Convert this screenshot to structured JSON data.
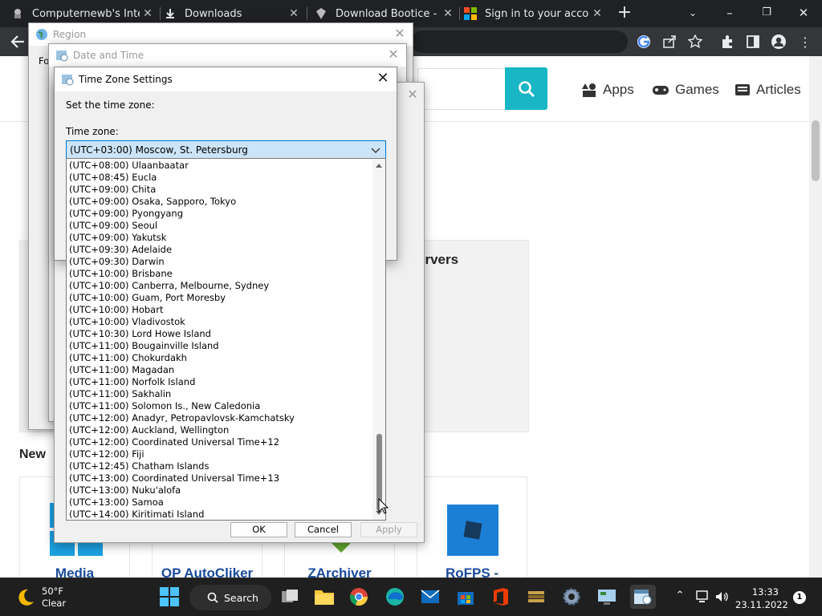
{
  "tabs": [
    {
      "title": "Computernewb's Intern",
      "close": "✕"
    },
    {
      "title": "Downloads",
      "close": "✕"
    },
    {
      "title": "Download Bootice - fre",
      "close": "✕"
    },
    {
      "title": "Sign in to your account",
      "close": "✕"
    }
  ],
  "window_controls": {
    "minimize": "–",
    "maximize": "❐",
    "close": "✕"
  },
  "site": {
    "nav": [
      {
        "label": "Apps"
      },
      {
        "label": "Games"
      },
      {
        "label": "Articles"
      }
    ],
    "servers_heading": "ervers",
    "new_heading": "New",
    "apps": [
      {
        "label": "Media"
      },
      {
        "label": "OP AutoCliker"
      },
      {
        "label": "ZArchiver"
      },
      {
        "label": "RoFPS -"
      }
    ]
  },
  "region_dialog": {
    "title": "Region",
    "fragment": "Fo"
  },
  "datetime_dialog": {
    "title": "Date and Time"
  },
  "timezone_dialog": {
    "title": "Time Zone Settings",
    "prompt": "Set the time zone:",
    "field_label": "Time zone:",
    "selected": "(UTC+03:00) Moscow, St. Petersburg",
    "options": [
      "(UTC+08:00) Ulaanbaatar",
      "(UTC+08:45) Eucla",
      "(UTC+09:00) Chita",
      "(UTC+09:00) Osaka, Sapporo, Tokyo",
      "(UTC+09:00) Pyongyang",
      "(UTC+09:00) Seoul",
      "(UTC+09:00) Yakutsk",
      "(UTC+09:30) Adelaide",
      "(UTC+09:30) Darwin",
      "(UTC+10:00) Brisbane",
      "(UTC+10:00) Canberra, Melbourne, Sydney",
      "(UTC+10:00) Guam, Port Moresby",
      "(UTC+10:00) Hobart",
      "(UTC+10:00) Vladivostok",
      "(UTC+10:30) Lord Howe Island",
      "(UTC+11:00) Bougainville Island",
      "(UTC+11:00) Chokurdakh",
      "(UTC+11:00) Magadan",
      "(UTC+11:00) Norfolk Island",
      "(UTC+11:00) Sakhalin",
      "(UTC+11:00) Solomon Is., New Caledonia",
      "(UTC+12:00) Anadyr, Petropavlovsk-Kamchatsky",
      "(UTC+12:00) Auckland, Wellington",
      "(UTC+12:00) Coordinated Universal Time+12",
      "(UTC+12:00) Fiji",
      "(UTC+12:45) Chatham Islands",
      "(UTC+13:00) Coordinated Universal Time+13",
      "(UTC+13:00) Nuku'alofa",
      "(UTC+13:00) Samoa",
      "(UTC+14:00) Kiritimati Island"
    ],
    "buttons": {
      "ok": "OK",
      "cancel": "Cancel",
      "apply": "Apply"
    }
  },
  "taskbar": {
    "weather_temp": "50°F",
    "weather_desc": "Clear",
    "search_label": "Search",
    "time": "13:33",
    "date": "23.11.2022",
    "notification_count": "1"
  },
  "colors": {
    "accent": "#19b6c6",
    "selection": "#cce4f7",
    "selection_border": "#0078d7",
    "link": "#1a4a9c"
  }
}
